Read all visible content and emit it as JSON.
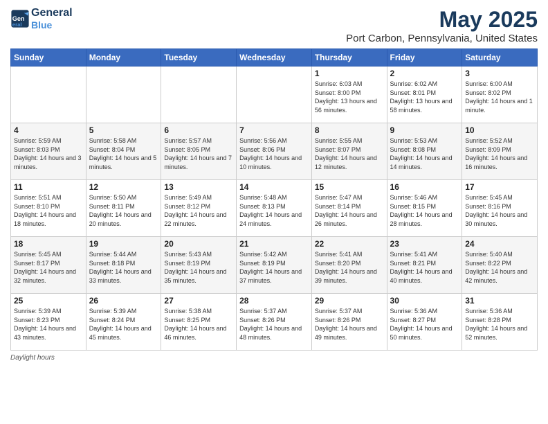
{
  "header": {
    "logo_line1": "General",
    "logo_line2": "Blue",
    "month_year": "May 2025",
    "location": "Port Carbon, Pennsylvania, United States"
  },
  "days_of_week": [
    "Sunday",
    "Monday",
    "Tuesday",
    "Wednesday",
    "Thursday",
    "Friday",
    "Saturday"
  ],
  "weeks": [
    [
      {
        "day": "",
        "info": ""
      },
      {
        "day": "",
        "info": ""
      },
      {
        "day": "",
        "info": ""
      },
      {
        "day": "",
        "info": ""
      },
      {
        "day": "1",
        "info": "Sunrise: 6:03 AM\nSunset: 8:00 PM\nDaylight: 13 hours\nand 56 minutes."
      },
      {
        "day": "2",
        "info": "Sunrise: 6:02 AM\nSunset: 8:01 PM\nDaylight: 13 hours\nand 58 minutes."
      },
      {
        "day": "3",
        "info": "Sunrise: 6:00 AM\nSunset: 8:02 PM\nDaylight: 14 hours\nand 1 minute."
      }
    ],
    [
      {
        "day": "4",
        "info": "Sunrise: 5:59 AM\nSunset: 8:03 PM\nDaylight: 14 hours\nand 3 minutes."
      },
      {
        "day": "5",
        "info": "Sunrise: 5:58 AM\nSunset: 8:04 PM\nDaylight: 14 hours\nand 5 minutes."
      },
      {
        "day": "6",
        "info": "Sunrise: 5:57 AM\nSunset: 8:05 PM\nDaylight: 14 hours\nand 7 minutes."
      },
      {
        "day": "7",
        "info": "Sunrise: 5:56 AM\nSunset: 8:06 PM\nDaylight: 14 hours\nand 10 minutes."
      },
      {
        "day": "8",
        "info": "Sunrise: 5:55 AM\nSunset: 8:07 PM\nDaylight: 14 hours\nand 12 minutes."
      },
      {
        "day": "9",
        "info": "Sunrise: 5:53 AM\nSunset: 8:08 PM\nDaylight: 14 hours\nand 14 minutes."
      },
      {
        "day": "10",
        "info": "Sunrise: 5:52 AM\nSunset: 8:09 PM\nDaylight: 14 hours\nand 16 minutes."
      }
    ],
    [
      {
        "day": "11",
        "info": "Sunrise: 5:51 AM\nSunset: 8:10 PM\nDaylight: 14 hours\nand 18 minutes."
      },
      {
        "day": "12",
        "info": "Sunrise: 5:50 AM\nSunset: 8:11 PM\nDaylight: 14 hours\nand 20 minutes."
      },
      {
        "day": "13",
        "info": "Sunrise: 5:49 AM\nSunset: 8:12 PM\nDaylight: 14 hours\nand 22 minutes."
      },
      {
        "day": "14",
        "info": "Sunrise: 5:48 AM\nSunset: 8:13 PM\nDaylight: 14 hours\nand 24 minutes."
      },
      {
        "day": "15",
        "info": "Sunrise: 5:47 AM\nSunset: 8:14 PM\nDaylight: 14 hours\nand 26 minutes."
      },
      {
        "day": "16",
        "info": "Sunrise: 5:46 AM\nSunset: 8:15 PM\nDaylight: 14 hours\nand 28 minutes."
      },
      {
        "day": "17",
        "info": "Sunrise: 5:45 AM\nSunset: 8:16 PM\nDaylight: 14 hours\nand 30 minutes."
      }
    ],
    [
      {
        "day": "18",
        "info": "Sunrise: 5:45 AM\nSunset: 8:17 PM\nDaylight: 14 hours\nand 32 minutes."
      },
      {
        "day": "19",
        "info": "Sunrise: 5:44 AM\nSunset: 8:18 PM\nDaylight: 14 hours\nand 33 minutes."
      },
      {
        "day": "20",
        "info": "Sunrise: 5:43 AM\nSunset: 8:19 PM\nDaylight: 14 hours\nand 35 minutes."
      },
      {
        "day": "21",
        "info": "Sunrise: 5:42 AM\nSunset: 8:19 PM\nDaylight: 14 hours\nand 37 minutes."
      },
      {
        "day": "22",
        "info": "Sunrise: 5:41 AM\nSunset: 8:20 PM\nDaylight: 14 hours\nand 39 minutes."
      },
      {
        "day": "23",
        "info": "Sunrise: 5:41 AM\nSunset: 8:21 PM\nDaylight: 14 hours\nand 40 minutes."
      },
      {
        "day": "24",
        "info": "Sunrise: 5:40 AM\nSunset: 8:22 PM\nDaylight: 14 hours\nand 42 minutes."
      }
    ],
    [
      {
        "day": "25",
        "info": "Sunrise: 5:39 AM\nSunset: 8:23 PM\nDaylight: 14 hours\nand 43 minutes."
      },
      {
        "day": "26",
        "info": "Sunrise: 5:39 AM\nSunset: 8:24 PM\nDaylight: 14 hours\nand 45 minutes."
      },
      {
        "day": "27",
        "info": "Sunrise: 5:38 AM\nSunset: 8:25 PM\nDaylight: 14 hours\nand 46 minutes."
      },
      {
        "day": "28",
        "info": "Sunrise: 5:37 AM\nSunset: 8:26 PM\nDaylight: 14 hours\nand 48 minutes."
      },
      {
        "day": "29",
        "info": "Sunrise: 5:37 AM\nSunset: 8:26 PM\nDaylight: 14 hours\nand 49 minutes."
      },
      {
        "day": "30",
        "info": "Sunrise: 5:36 AM\nSunset: 8:27 PM\nDaylight: 14 hours\nand 50 minutes."
      },
      {
        "day": "31",
        "info": "Sunrise: 5:36 AM\nSunset: 8:28 PM\nDaylight: 14 hours\nand 52 minutes."
      }
    ]
  ],
  "footer": {
    "label": "Daylight hours"
  }
}
